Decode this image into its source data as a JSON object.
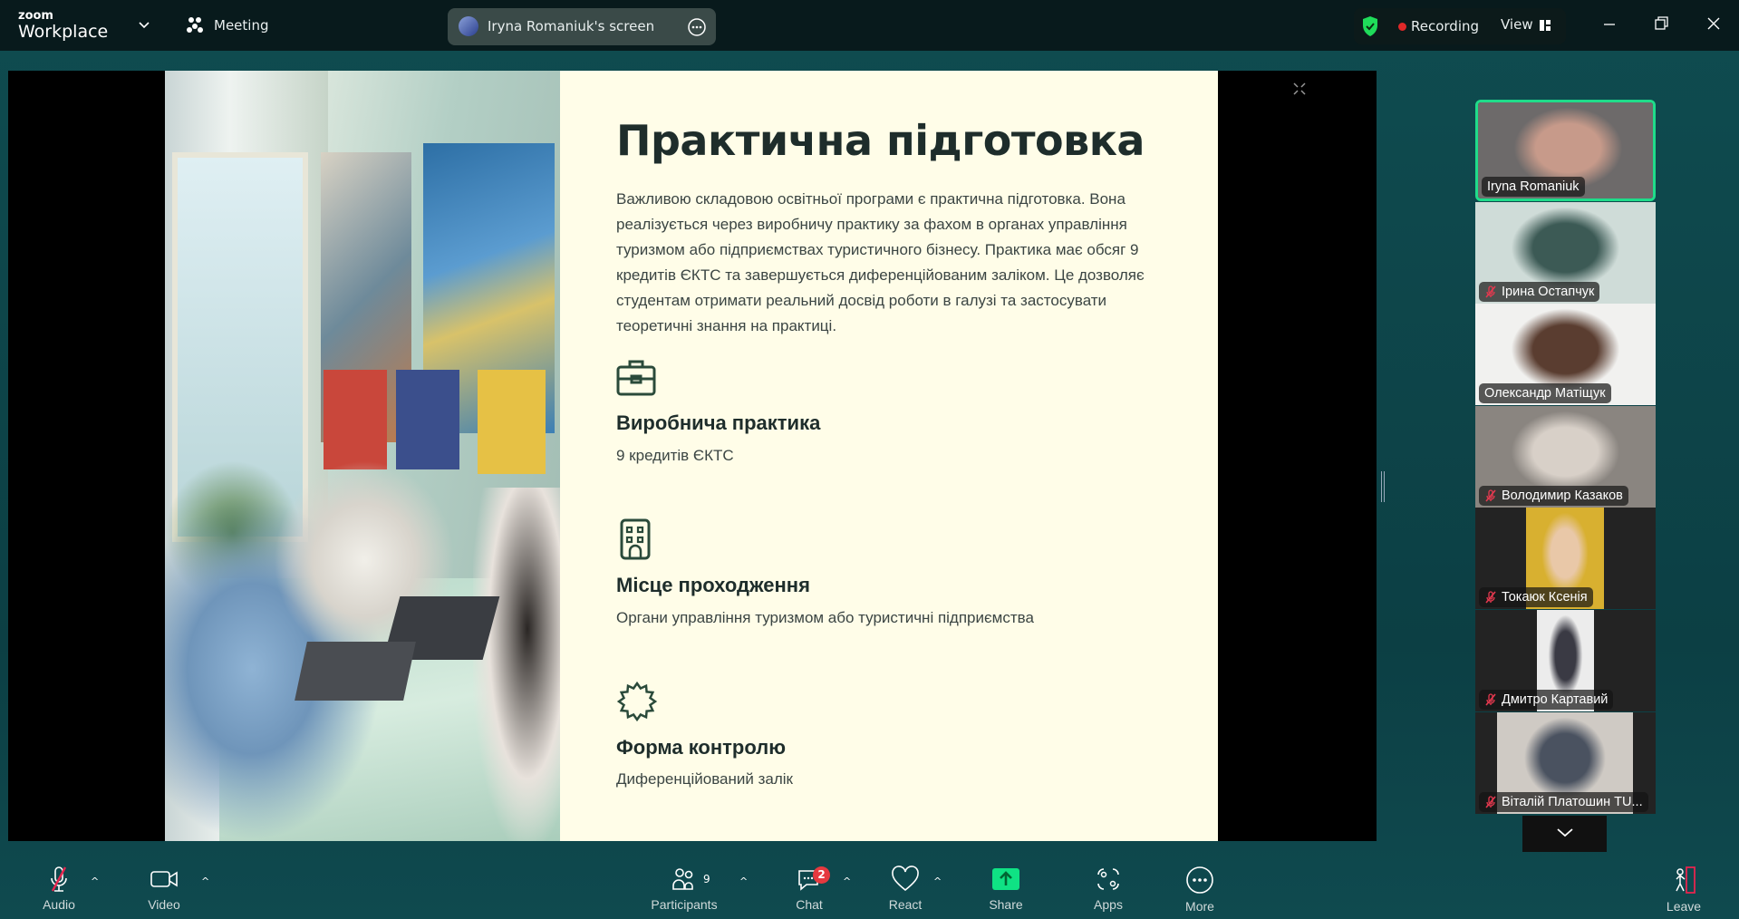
{
  "app": {
    "logo_small": "zoom",
    "logo_big": "Workplace",
    "meeting_label": "Meeting",
    "screen_label": "Iryna Romaniuk's screen",
    "recording_label": "Recording",
    "view_label": "View"
  },
  "colors": {
    "accent_green": "#1fdc8a",
    "recording_red": "#e02828",
    "share_green": "#0fe284",
    "badge_red": "#e5393f"
  },
  "slide": {
    "title": "Практична підготовка",
    "paragraph": "Важливою складовою освітньої програми є практична підготовка. Вона реалізується через виробничу практику за фахом в органах управління туризмом або підприємствах туристичного бізнесу. Практика має обсяг 9 кредитів ЄКТС та завершується диференційованим заліком. Це дозволяє студентам отримати реальний досвід роботи в галузі та застосувати теоретичні знання на практиці.",
    "items": [
      {
        "icon": "briefcase-icon",
        "heading": "Виробнича практика",
        "text": "9 кредитів ЄКТС"
      },
      {
        "icon": "building-icon",
        "heading": "Місце проходження",
        "text": "Органи управління туризмом або туристичні підприємства"
      },
      {
        "icon": "badge-icon",
        "heading": "Форма контролю",
        "text": "Диференційований залік"
      }
    ]
  },
  "participants": [
    {
      "name": "Iryna Romaniuk",
      "muted": false,
      "active": true
    },
    {
      "name": "Ірина Остапчук",
      "muted": true
    },
    {
      "name": "Олександр Матіщук",
      "muted": false
    },
    {
      "name": "Володимир Казаков",
      "muted": true
    },
    {
      "name": "Токаюк Ксенія",
      "muted": true
    },
    {
      "name": "Дмитро Картавий",
      "muted": true
    },
    {
      "name": "Віталій Платошин TU...",
      "muted": true
    }
  ],
  "toolbar": {
    "audio": "Audio",
    "video": "Video",
    "participants": "Participants",
    "participants_count": "9",
    "chat": "Chat",
    "chat_badge": "2",
    "react": "React",
    "share": "Share",
    "apps": "Apps",
    "more": "More",
    "leave": "Leave"
  }
}
